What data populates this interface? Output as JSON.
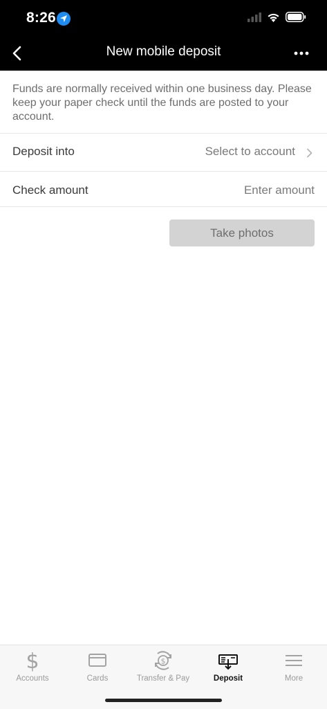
{
  "status_bar": {
    "time": "8:26"
  },
  "nav": {
    "title": "New mobile deposit"
  },
  "info_text": "Funds are normally received within one business day. Please keep your paper check until the funds are posted to your account.",
  "form": {
    "deposit_into": {
      "label": "Deposit into",
      "value": "Select to account"
    },
    "check_amount": {
      "label": "Check amount",
      "placeholder": "Enter amount"
    }
  },
  "take_photos_label": "Take photos",
  "tabs": [
    {
      "label": "Accounts",
      "icon": "dollar-icon",
      "active": false
    },
    {
      "label": "Cards",
      "icon": "card-icon",
      "active": false
    },
    {
      "label": "Transfer & Pay",
      "icon": "transfer-icon",
      "active": false
    },
    {
      "label": "Deposit",
      "icon": "deposit-check-icon",
      "active": true
    },
    {
      "label": "More",
      "icon": "menu-icon",
      "active": false
    }
  ],
  "colors": {
    "header": "#000000",
    "location_dot": "#1f8cf2",
    "button_disabled": "#d3d3d3"
  }
}
